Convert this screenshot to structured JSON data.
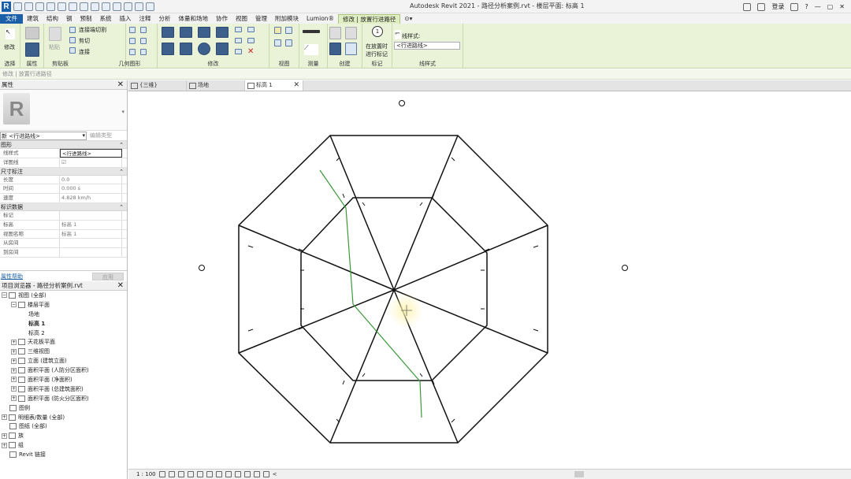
{
  "window": {
    "title": "Autodesk Revit 2021 - 路径分析案例.rvt - 楼层平面: 标高 1",
    "login": "登录",
    "help": "?"
  },
  "menu": {
    "tabs": [
      "文件",
      "建筑",
      "结构",
      "钢",
      "预制",
      "系统",
      "插入",
      "注释",
      "分析",
      "体量和场地",
      "协作",
      "视图",
      "管理",
      "附加模块",
      "Lumion®",
      "修改 | 放置行进路径"
    ]
  },
  "ribbon": {
    "select_label": "选择",
    "properties_label": "属性",
    "clipboard_label": "剪贴板",
    "geometry_label": "几何图形",
    "modify_label": "修改",
    "view_label": "视图",
    "measure_label": "测量",
    "create_label": "创建",
    "tag_label": "标记",
    "linestyle_label": "线样式",
    "modify_btn": "修改",
    "paste_btn": "粘贴",
    "join_cut": "连接端切割",
    "cut": "剪切",
    "join": "连接",
    "tag_on_place_1": "在放置时",
    "tag_on_place_2": "进行标记",
    "linestyle_text": "线样式:",
    "linestyle_value": "<行进路线>"
  },
  "optionsbar": {
    "text": "修改 | 放置行进路径"
  },
  "properties": {
    "title": "属性",
    "type_select": "新 <行进路线>",
    "edit_type": "编辑类型",
    "groups": [
      {
        "name": "图形",
        "rows": [
          {
            "key": "线样式",
            "value": "<行进路线>"
          },
          {
            "key": "详图线",
            "value": "☑"
          }
        ]
      },
      {
        "name": "尺寸标注",
        "rows": [
          {
            "key": "长度",
            "value": "0.0"
          },
          {
            "key": "时间",
            "value": "0.000 s"
          },
          {
            "key": "速度",
            "value": "4.828 km/h"
          }
        ]
      },
      {
        "name": "标识数据",
        "rows": [
          {
            "key": "标记",
            "value": ""
          },
          {
            "key": "标高",
            "value": "标高 1"
          },
          {
            "key": "视图名称",
            "value": "标高 1"
          },
          {
            "key": "从房间",
            "value": ""
          },
          {
            "key": "到房间",
            "value": ""
          }
        ]
      }
    ],
    "help_link": "属性帮助",
    "apply": "应用"
  },
  "browser": {
    "title": "项目浏览器 - 路径分析案例.rvt",
    "items": [
      {
        "indent": 0,
        "toggle": "−",
        "label": "视图 (全部)"
      },
      {
        "indent": 1,
        "toggle": "−",
        "label": "楼层平面"
      },
      {
        "indent": 2,
        "toggle": "",
        "label": "场地"
      },
      {
        "indent": 2,
        "toggle": "",
        "label": "标高 1",
        "bold": true
      },
      {
        "indent": 2,
        "toggle": "",
        "label": "标高 2"
      },
      {
        "indent": 1,
        "toggle": "+",
        "label": "天花板平面"
      },
      {
        "indent": 1,
        "toggle": "+",
        "label": "三维视图"
      },
      {
        "indent": 1,
        "toggle": "+",
        "label": "立面 (建筑立面)"
      },
      {
        "indent": 1,
        "toggle": "+",
        "label": "面积平面 (人防分区面积)"
      },
      {
        "indent": 1,
        "toggle": "+",
        "label": "面积平面 (净面积)"
      },
      {
        "indent": 1,
        "toggle": "+",
        "label": "面积平面 (总建筑面积)"
      },
      {
        "indent": 1,
        "toggle": "+",
        "label": "面积平面 (防火分区面积)"
      },
      {
        "indent": 0,
        "toggle": "",
        "label": "图例"
      },
      {
        "indent": 0,
        "toggle": "+",
        "label": "明细表/数量 (全部)"
      },
      {
        "indent": 0,
        "toggle": "",
        "label": "图纸 (全部)"
      },
      {
        "indent": 0,
        "toggle": "+",
        "label": "族"
      },
      {
        "indent": 0,
        "toggle": "+",
        "label": "组"
      },
      {
        "indent": 0,
        "toggle": "",
        "label": "Revit 链接"
      }
    ]
  },
  "viewtabs": [
    {
      "label": "{三维}",
      "active": false
    },
    {
      "label": "场地",
      "active": false
    },
    {
      "label": "标高 1",
      "active": true
    }
  ],
  "statusbar": {
    "scale": "1 : 100",
    "arrow": "<"
  },
  "colors": {
    "accent": "#1a5fa8",
    "context_tab": "#dfeec3",
    "path_line": "#3a9a3a"
  }
}
